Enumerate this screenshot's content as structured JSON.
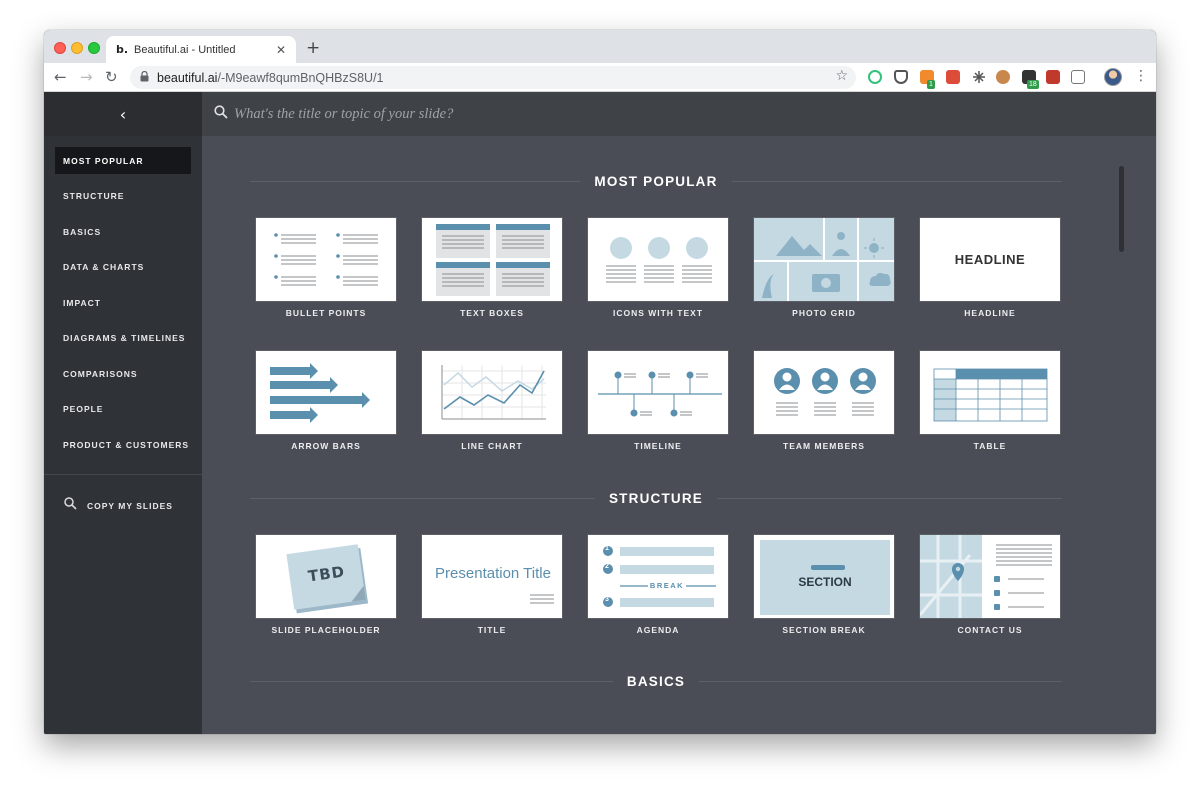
{
  "browser": {
    "tab_favicon": "b.",
    "tab_title": "Beautiful.ai - Untitled",
    "tab_close": "✕",
    "new_tab": "+",
    "back": "←",
    "forward": "→",
    "reload": "↻",
    "url_host": "beautiful.ai",
    "url_path": "/-M9eawf8qumBnQHBzS8U/1",
    "star": "☆",
    "extension_badges": [
      "1",
      "18"
    ],
    "menu": "⋮"
  },
  "sidebar": {
    "collapse": "‹",
    "items": [
      {
        "label": "MOST POPULAR"
      },
      {
        "label": "STRUCTURE"
      },
      {
        "label": "BASICS"
      },
      {
        "label": "DATA & CHARTS"
      },
      {
        "label": "IMPACT"
      },
      {
        "label": "DIAGRAMS & TIMELINES"
      },
      {
        "label": "COMPARISONS"
      },
      {
        "label": "PEOPLE"
      },
      {
        "label": "PRODUCT & CUSTOMERS"
      }
    ],
    "active": "MOST POPULAR",
    "copy_label": "COPY MY SLIDES"
  },
  "search": {
    "placeholder": "What's the title or topic of your slide?"
  },
  "sections": [
    {
      "title": "MOST POPULAR",
      "cards": [
        {
          "label": "BULLET POINTS",
          "icon": "bullet-points"
        },
        {
          "label": "TEXT BOXES",
          "icon": "text-boxes"
        },
        {
          "label": "ICONS WITH TEXT",
          "icon": "icons-with-text"
        },
        {
          "label": "PHOTO GRID",
          "icon": "photo-grid"
        },
        {
          "label": "HEADLINE",
          "icon": "headline",
          "thumb_text": "HEADLINE"
        },
        {
          "label": "ARROW BARS",
          "icon": "arrow-bars"
        },
        {
          "label": "LINE CHART",
          "icon": "line-chart"
        },
        {
          "label": "TIMELINE",
          "icon": "timeline"
        },
        {
          "label": "TEAM MEMBERS",
          "icon": "team-members"
        },
        {
          "label": "TABLE",
          "icon": "table"
        }
      ]
    },
    {
      "title": "STRUCTURE",
      "cards": [
        {
          "label": "SLIDE PLACEHOLDER",
          "icon": "sticky-note",
          "thumb_text": "TBD"
        },
        {
          "label": "TITLE",
          "icon": "title",
          "thumb_text": "Presentation Title"
        },
        {
          "label": "AGENDA",
          "icon": "agenda",
          "thumb_text": "BREAK",
          "numbers": [
            "1",
            "2",
            "3"
          ]
        },
        {
          "label": "SECTION BREAK",
          "icon": "section-break",
          "thumb_text": "SECTION"
        },
        {
          "label": "CONTACT US",
          "icon": "contact-us"
        }
      ]
    },
    {
      "title": "BASICS",
      "cards": []
    }
  ],
  "colors": {
    "accent": "#5b8fae",
    "accent_light": "#c5d9e3",
    "sidebar_bg": "#2f3237",
    "content_bg": "#4a4d55"
  }
}
